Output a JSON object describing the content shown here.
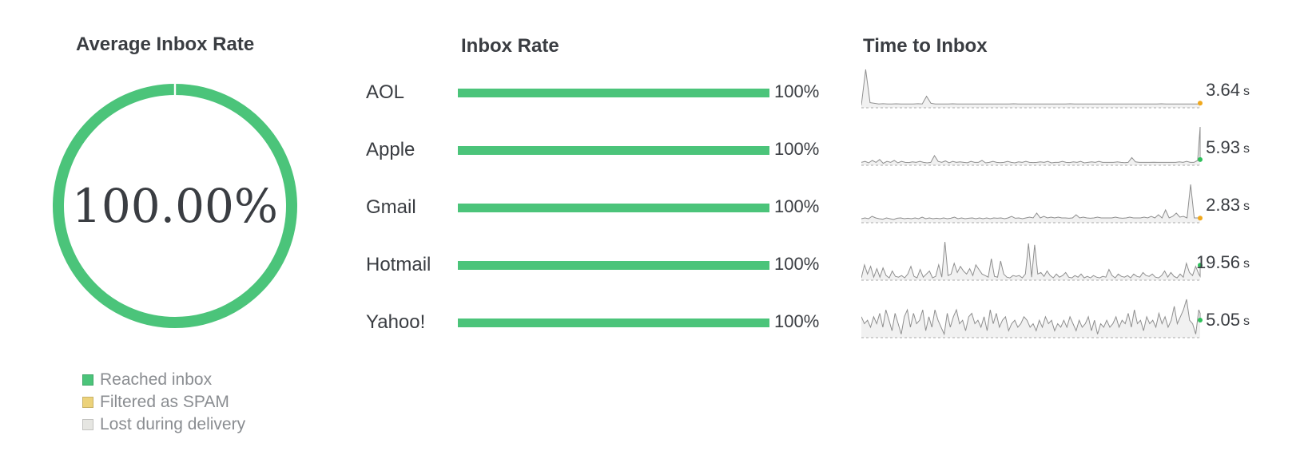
{
  "sections": {
    "average_title": "Average Inbox Rate",
    "rate_title": "Inbox Rate",
    "time_title": "Time to Inbox"
  },
  "donut": {
    "value_text": "100.00%",
    "reached_fraction": 1.0,
    "color": "#4bc47a"
  },
  "legend": [
    {
      "label": "Reached inbox",
      "color": "#4bc47a"
    },
    {
      "label": "Filtered as SPAM",
      "color": "#ecd27a"
    },
    {
      "label": "Lost during delivery",
      "color": "#e6e6e2"
    }
  ],
  "colors": {
    "bar": "#4bc47a",
    "track": "#eeeeee",
    "spark_line": "#8f8f8f",
    "spark_baseline": "#aaaaaa",
    "dot_green": "#2ec05a",
    "dot_orange": "#f0a81c"
  },
  "chart_data": [
    {
      "type": "bar",
      "title": "Inbox Rate",
      "categories": [
        "AOL",
        "Apple",
        "Gmail",
        "Hotmail",
        "Yahoo!"
      ],
      "values": [
        100,
        100,
        100,
        100,
        100
      ],
      "value_labels": [
        "100%",
        "100%",
        "100%",
        "100%",
        "100%"
      ],
      "ylim": [
        0,
        100
      ]
    },
    {
      "type": "line",
      "title": "Time to Inbox",
      "series": [
        {
          "name": "AOL",
          "latest_label": "3.64",
          "unit": "s",
          "dot": "orange",
          "values": [
            2,
            30,
            4,
            3.5,
            3,
            3.2,
            3,
            3,
            3.1,
            3,
            3,
            3,
            3,
            3.2,
            3,
            9,
            3.5,
            3,
            3,
            3,
            3,
            3.1,
            3,
            3,
            3,
            3,
            3,
            3,
            3,
            3,
            3,
            3,
            3,
            3,
            3,
            3.1,
            3,
            3,
            3,
            3,
            3,
            3,
            3,
            3,
            3,
            3,
            3,
            3,
            3.1,
            3,
            3,
            3,
            3,
            3,
            3,
            3,
            3,
            3,
            3,
            3,
            3,
            3,
            3,
            3,
            3,
            3,
            3,
            3,
            3,
            3.1,
            3,
            3,
            3,
            3,
            3,
            3,
            3,
            3,
            3,
            3.64
          ]
        },
        {
          "name": "Apple",
          "latest_label": "5.93",
          "unit": "s",
          "dot": "green",
          "values": [
            3,
            4,
            2.5,
            5,
            3,
            6,
            2,
            4,
            3,
            5,
            2.5,
            4,
            3,
            2.8,
            3.5,
            3,
            4,
            3,
            2.5,
            3,
            10,
            4,
            3,
            4.5,
            2.5,
            4,
            3,
            3.5,
            3,
            2.6,
            4,
            3,
            3,
            5,
            2.5,
            3,
            4,
            3,
            2.7,
            3,
            4,
            3,
            2.5,
            3.5,
            3,
            4,
            3,
            2.8,
            3,
            3.5,
            3,
            4,
            2.5,
            3,
            3,
            4,
            3,
            2.8,
            3.5,
            3,
            4,
            2.5,
            3,
            3.5,
            3,
            4,
            3,
            3,
            3,
            3,
            3.5,
            3,
            2.7,
            3,
            8,
            3.5,
            3,
            3,
            3,
            3,
            3.2,
            3,
            3,
            3,
            3,
            3,
            3,
            3.5,
            3,
            4,
            3,
            3,
            5,
            40,
            5.93
          ]
        },
        {
          "name": "Gmail",
          "latest_label": "2.83",
          "unit": "s",
          "dot": "orange",
          "values": [
            2.5,
            3,
            2.5,
            4,
            3,
            2.5,
            2.2,
            3,
            2.5,
            2,
            2.8,
            3,
            2.5,
            2.8,
            2.5,
            3,
            2.5,
            3.5,
            2.5,
            3,
            2.5,
            2.8,
            2.5,
            3,
            2.5,
            2.8,
            3.5,
            2.5,
            3,
            2.5,
            2.8,
            3,
            2.5,
            3,
            2.5,
            3,
            2.5,
            3,
            2.8,
            3,
            2.5,
            3,
            4,
            2.8,
            3,
            2.5,
            3,
            3.5,
            3,
            6,
            3,
            4,
            3,
            3.5,
            3,
            3.5,
            3,
            3,
            2.8,
            3,
            5,
            3,
            3.5,
            3,
            2.8,
            3,
            3.5,
            3,
            3,
            3,
            3,
            3.5,
            3,
            2.8,
            3,
            3.5,
            3,
            3,
            3,
            3.5,
            3,
            4,
            3,
            5,
            3,
            8,
            3,
            4,
            6,
            3.5,
            4,
            3,
            24,
            3,
            3,
            2.5,
            2.83
          ]
        },
        {
          "name": "Hotmail",
          "latest_label": "19.56",
          "unit": "s",
          "dot": "green",
          "values": [
            3,
            20,
            8,
            18,
            4,
            15,
            4,
            16,
            6,
            3,
            12,
            5,
            4,
            6,
            3,
            8,
            18,
            5,
            3,
            14,
            4,
            8,
            12,
            3,
            5,
            20,
            4,
            50,
            6,
            8,
            22,
            10,
            18,
            12,
            8,
            15,
            6,
            20,
            14,
            8,
            6,
            4,
            28,
            5,
            4,
            25,
            8,
            4,
            3,
            6,
            5,
            6,
            3,
            8,
            48,
            4,
            46,
            8,
            10,
            5,
            12,
            6,
            3,
            8,
            4,
            6,
            10,
            4,
            3,
            6,
            4,
            8,
            3,
            5,
            3,
            6,
            4,
            3,
            5,
            4,
            14,
            6,
            3,
            8,
            5,
            4,
            6,
            3,
            8,
            5,
            4,
            10,
            6,
            5,
            8,
            4,
            3,
            6,
            12,
            4,
            10,
            5,
            3,
            8,
            4,
            22,
            10,
            6,
            18,
            8,
            5,
            19.56
          ]
        },
        {
          "name": "Yahoo!",
          "latest_label": "5.05",
          "unit": "s",
          "dot": "green",
          "values": [
            6,
            4,
            5,
            3,
            6,
            4,
            7,
            3,
            8,
            5,
            2,
            7,
            4,
            1,
            6,
            8,
            3,
            7,
            4,
            5,
            8,
            2,
            6,
            3,
            8,
            5,
            3,
            1,
            7,
            3,
            6,
            8,
            4,
            5,
            2,
            6,
            7,
            4,
            5,
            3,
            6,
            2,
            8,
            4,
            7,
            3,
            5,
            6,
            2,
            4,
            5,
            3,
            4,
            6,
            5,
            3,
            4,
            2,
            5,
            3,
            6,
            4,
            5,
            2,
            4,
            3,
            5,
            3,
            6,
            4,
            2,
            5,
            3,
            4,
            6,
            2,
            5,
            1,
            4,
            3,
            5,
            3,
            4,
            6,
            3,
            5,
            4,
            7,
            3,
            8,
            4,
            5,
            2,
            6,
            4,
            5,
            3,
            7,
            4,
            6,
            3,
            5,
            9,
            4,
            6,
            8,
            11,
            5,
            4,
            1,
            8,
            7,
            5.05
          ]
        }
      ]
    }
  ]
}
